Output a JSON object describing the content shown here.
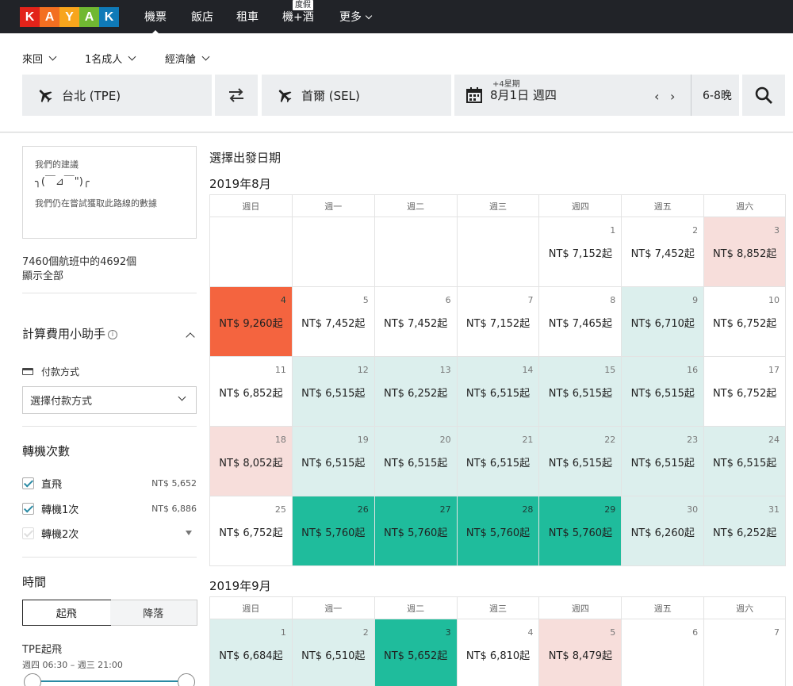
{
  "nav": {
    "logo_letters": [
      "K",
      "A",
      "Y",
      "A",
      "K"
    ],
    "logo_colors": [
      "#e2231a",
      "#f36f21",
      "#f8a51c",
      "#70b832",
      "#0f7ab8"
    ],
    "items": [
      "機票",
      "飯店",
      "租車",
      "機+酒",
      "更多"
    ],
    "badge": "度假",
    "active_index": 0
  },
  "search": {
    "trip_type": "來回",
    "travelers": "1名成人",
    "cabin": "經濟艙",
    "origin": "台北 (TPE)",
    "destination": "首爾 (SEL)",
    "date_sub": "+4星期",
    "date": "8月1日 週四",
    "nights": "6-8晚",
    "icons": [
      "plane-icon",
      "swap-icon",
      "calendar-icon",
      "search-icon"
    ]
  },
  "sidebar": {
    "rec_title": "我們的建議",
    "rec_face": "╮(￣⊿￣\")╭",
    "rec_msg": "我們仍在嘗試獲取此路線的數據",
    "count": "7460個航班中的4692個",
    "show_all": "顯示全部",
    "calc_title": "計算費用小助手",
    "pay_label": "付款方式",
    "pay_select": "選擇付款方式",
    "stops_title": "轉機次數",
    "stops": [
      {
        "label": "直飛",
        "price": "NT$ 5,652",
        "checked": true,
        "disabled": false
      },
      {
        "label": "轉機1次",
        "price": "NT$ 6,886",
        "checked": true,
        "disabled": false
      },
      {
        "label": "轉機2次",
        "price": "",
        "checked": true,
        "disabled": true
      }
    ],
    "time_title": "時間",
    "tab_depart": "起飛",
    "tab_arrive": "降落",
    "tpe_depart": "TPE起飛",
    "time_range": "週四 06:30 – 週三 21:00"
  },
  "calendar": {
    "title": "選擇出發日期",
    "weekdays": [
      "週日",
      "週一",
      "週二",
      "週三",
      "週四",
      "週五",
      "週六"
    ],
    "months": [
      {
        "name": "2019年8月",
        "rows": [
          [
            null,
            null,
            null,
            null,
            {
              "day": "1",
              "price": "NT$ 7,152起",
              "level": "none"
            },
            {
              "day": "2",
              "price": "NT$ 7,452起",
              "level": "none"
            },
            {
              "day": "3",
              "price": "NT$ 8,852起",
              "level": "pink"
            }
          ],
          [
            {
              "day": "4",
              "price": "NT$ 9,260起",
              "level": "red"
            },
            {
              "day": "5",
              "price": "NT$ 7,452起",
              "level": "none"
            },
            {
              "day": "6",
              "price": "NT$ 7,452起",
              "level": "none"
            },
            {
              "day": "7",
              "price": "NT$ 7,152起",
              "level": "none"
            },
            {
              "day": "8",
              "price": "NT$ 7,465起",
              "level": "none"
            },
            {
              "day": "9",
              "price": "NT$ 6,710起",
              "level": "mint"
            },
            {
              "day": "10",
              "price": "NT$ 6,752起",
              "level": "none"
            }
          ],
          [
            {
              "day": "11",
              "price": "NT$ 6,852起",
              "level": "none"
            },
            {
              "day": "12",
              "price": "NT$ 6,515起",
              "level": "mint"
            },
            {
              "day": "13",
              "price": "NT$ 6,252起",
              "level": "mint"
            },
            {
              "day": "14",
              "price": "NT$ 6,515起",
              "level": "mint"
            },
            {
              "day": "15",
              "price": "NT$ 6,515起",
              "level": "mint"
            },
            {
              "day": "16",
              "price": "NT$ 6,515起",
              "level": "mint"
            },
            {
              "day": "17",
              "price": "NT$ 6,752起",
              "level": "none"
            }
          ],
          [
            {
              "day": "18",
              "price": "NT$ 8,052起",
              "level": "pink"
            },
            {
              "day": "19",
              "price": "NT$ 6,515起",
              "level": "mint"
            },
            {
              "day": "20",
              "price": "NT$ 6,515起",
              "level": "mint"
            },
            {
              "day": "21",
              "price": "NT$ 6,515起",
              "level": "mint"
            },
            {
              "day": "22",
              "price": "NT$ 6,515起",
              "level": "mint"
            },
            {
              "day": "23",
              "price": "NT$ 6,515起",
              "level": "mint"
            },
            {
              "day": "24",
              "price": "NT$ 6,515起",
              "level": "mint"
            }
          ],
          [
            {
              "day": "25",
              "price": "NT$ 6,752起",
              "level": "none"
            },
            {
              "day": "26",
              "price": "NT$ 5,760起",
              "level": "teal"
            },
            {
              "day": "27",
              "price": "NT$ 5,760起",
              "level": "teal"
            },
            {
              "day": "28",
              "price": "NT$ 5,760起",
              "level": "teal"
            },
            {
              "day": "29",
              "price": "NT$ 5,760起",
              "level": "teal"
            },
            {
              "day": "30",
              "price": "NT$ 6,260起",
              "level": "mint"
            },
            {
              "day": "31",
              "price": "NT$ 6,252起",
              "level": "mint"
            }
          ]
        ]
      },
      {
        "name": "2019年9月",
        "rows": [
          [
            {
              "day": "1",
              "price": "NT$ 6,684起",
              "level": "mint"
            },
            {
              "day": "2",
              "price": "NT$ 6,510起",
              "level": "mint"
            },
            {
              "day": "3",
              "price": "NT$ 5,652起",
              "level": "teal"
            },
            {
              "day": "4",
              "price": "NT$ 6,810起",
              "level": "none"
            },
            {
              "day": "5",
              "price": "NT$ 8,479起",
              "level": "pink"
            },
            {
              "day": "6",
              "price": "",
              "level": "none"
            },
            {
              "day": "7",
              "price": "",
              "level": "none"
            }
          ]
        ]
      }
    ]
  }
}
